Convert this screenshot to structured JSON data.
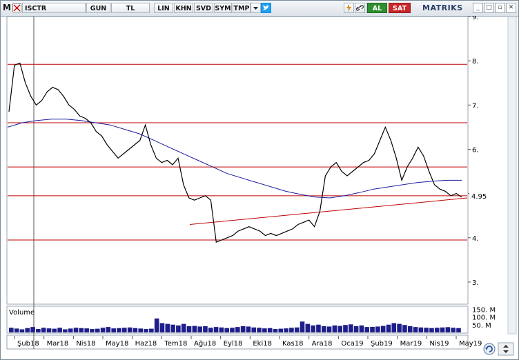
{
  "toolbar": {
    "menu_letter": "M",
    "symbol": "ISCTR",
    "period_label": "GUN",
    "currency_label": "TL",
    "scale_label": "LIN",
    "btn_khn": "KHN",
    "btn_svd": "SVD",
    "btn_sym": "SYM",
    "btn_tmp": "TMP",
    "buy_label": "AL",
    "sell_label": "SAT",
    "brand": "MATRIKS",
    "icons": [
      "lightning-icon",
      "link-icon",
      "refresh-icon",
      "twitter-icon",
      "dropdown-arrow-icon",
      "minimize-icon",
      "maximize-icon",
      "close-icon"
    ]
  },
  "colors": {
    "price_line": "#000000",
    "moving_average": "#1a1aa0",
    "horizontal_levels": "#c00000",
    "trend_line": "#c00000",
    "volume_bars": "#1e1e8a",
    "highlight_label_bg": "#ffffff"
  },
  "chart_data": {
    "type": "line",
    "title": "",
    "xlabel": "",
    "ylabel": "",
    "x_ticks": [
      "Şub18",
      "Mar18",
      "Nis18",
      "May18",
      "Haz18",
      "Tem18",
      "Ağu18",
      "Eyl18",
      "Eki18",
      "Kas18",
      "Ara18",
      "Oca19",
      "Şub19",
      "Mar19",
      "Nis19",
      "May19"
    ],
    "y_ticks": [
      "9.",
      "8.",
      "7.",
      "6.",
      "5.",
      "4.",
      "3."
    ],
    "ylim": [
      2.5,
      9.0
    ],
    "current_price_label": "4.95",
    "horizontal_levels": [
      7.92,
      6.6,
      5.6,
      4.95,
      3.95
    ],
    "trend_line": {
      "from": [
        "Ağu18",
        4.3
      ],
      "to": [
        "May19",
        4.9
      ]
    },
    "grid": false,
    "series": [
      {
        "values": [
          6.85,
          7.9,
          7.95,
          7.5,
          7.2,
          7.0,
          7.1,
          7.3,
          7.4,
          7.35,
          7.2,
          7.0,
          6.9,
          6.75,
          6.7,
          6.6,
          6.4,
          6.3,
          6.1,
          5.95,
          5.8,
          5.9,
          6.0,
          6.1,
          6.2,
          6.55,
          6.1,
          5.8,
          5.7,
          5.75,
          5.65,
          5.8,
          5.2,
          4.9,
          4.85,
          4.9,
          4.95,
          4.85,
          3.9,
          3.95,
          4.0,
          4.05,
          4.15,
          4.2,
          4.25,
          4.2,
          4.15,
          4.05,
          4.1,
          4.05,
          4.1,
          4.15,
          4.2,
          4.3,
          4.35,
          4.4,
          4.25,
          4.6,
          5.4,
          5.6,
          5.7,
          5.5,
          5.4,
          5.5,
          5.6,
          5.7,
          5.75,
          5.9,
          6.2,
          6.5,
          6.2,
          5.8,
          5.3,
          5.6,
          5.8,
          6.05,
          5.85,
          5.5,
          5.2,
          5.1,
          5.05,
          4.95,
          5.0,
          4.92
        ]
      },
      {
        "values": [
          6.5,
          6.6,
          6.65,
          6.68,
          6.68,
          6.65,
          6.6,
          6.55,
          6.45,
          6.35,
          6.2,
          6.05,
          5.9,
          5.75,
          5.6,
          5.45,
          5.35,
          5.25,
          5.15,
          5.05,
          4.98,
          4.92,
          4.9,
          4.95,
          5.02,
          5.1,
          5.15,
          5.2,
          5.25,
          5.28,
          5.3,
          5.3
        ]
      }
    ],
    "volume": {
      "label": "Volume",
      "y_ticks": [
        "150. M",
        "100. M",
        "50. M"
      ],
      "values": [
        30,
        25,
        20,
        28,
        35,
        22,
        30,
        26,
        24,
        30,
        20,
        25,
        30,
        28,
        26,
        22,
        24,
        30,
        35,
        26,
        28,
        30,
        32,
        28,
        25,
        22,
        24,
        90,
        60,
        55,
        50,
        45,
        55,
        40,
        42,
        38,
        40,
        30,
        35,
        32,
        28,
        30,
        35,
        40,
        38,
        32,
        30,
        26,
        28,
        22,
        24,
        26,
        30,
        32,
        70,
        55,
        45,
        50,
        40,
        38,
        45,
        42,
        48,
        52,
        40,
        45,
        35,
        36,
        38,
        42,
        50,
        60,
        55,
        48,
        40,
        35,
        32,
        30,
        28,
        30,
        32,
        34,
        30,
        28
      ]
    }
  },
  "bottom": {
    "icons": [
      "refresh-circle-icon",
      "stepper-icon"
    ]
  }
}
